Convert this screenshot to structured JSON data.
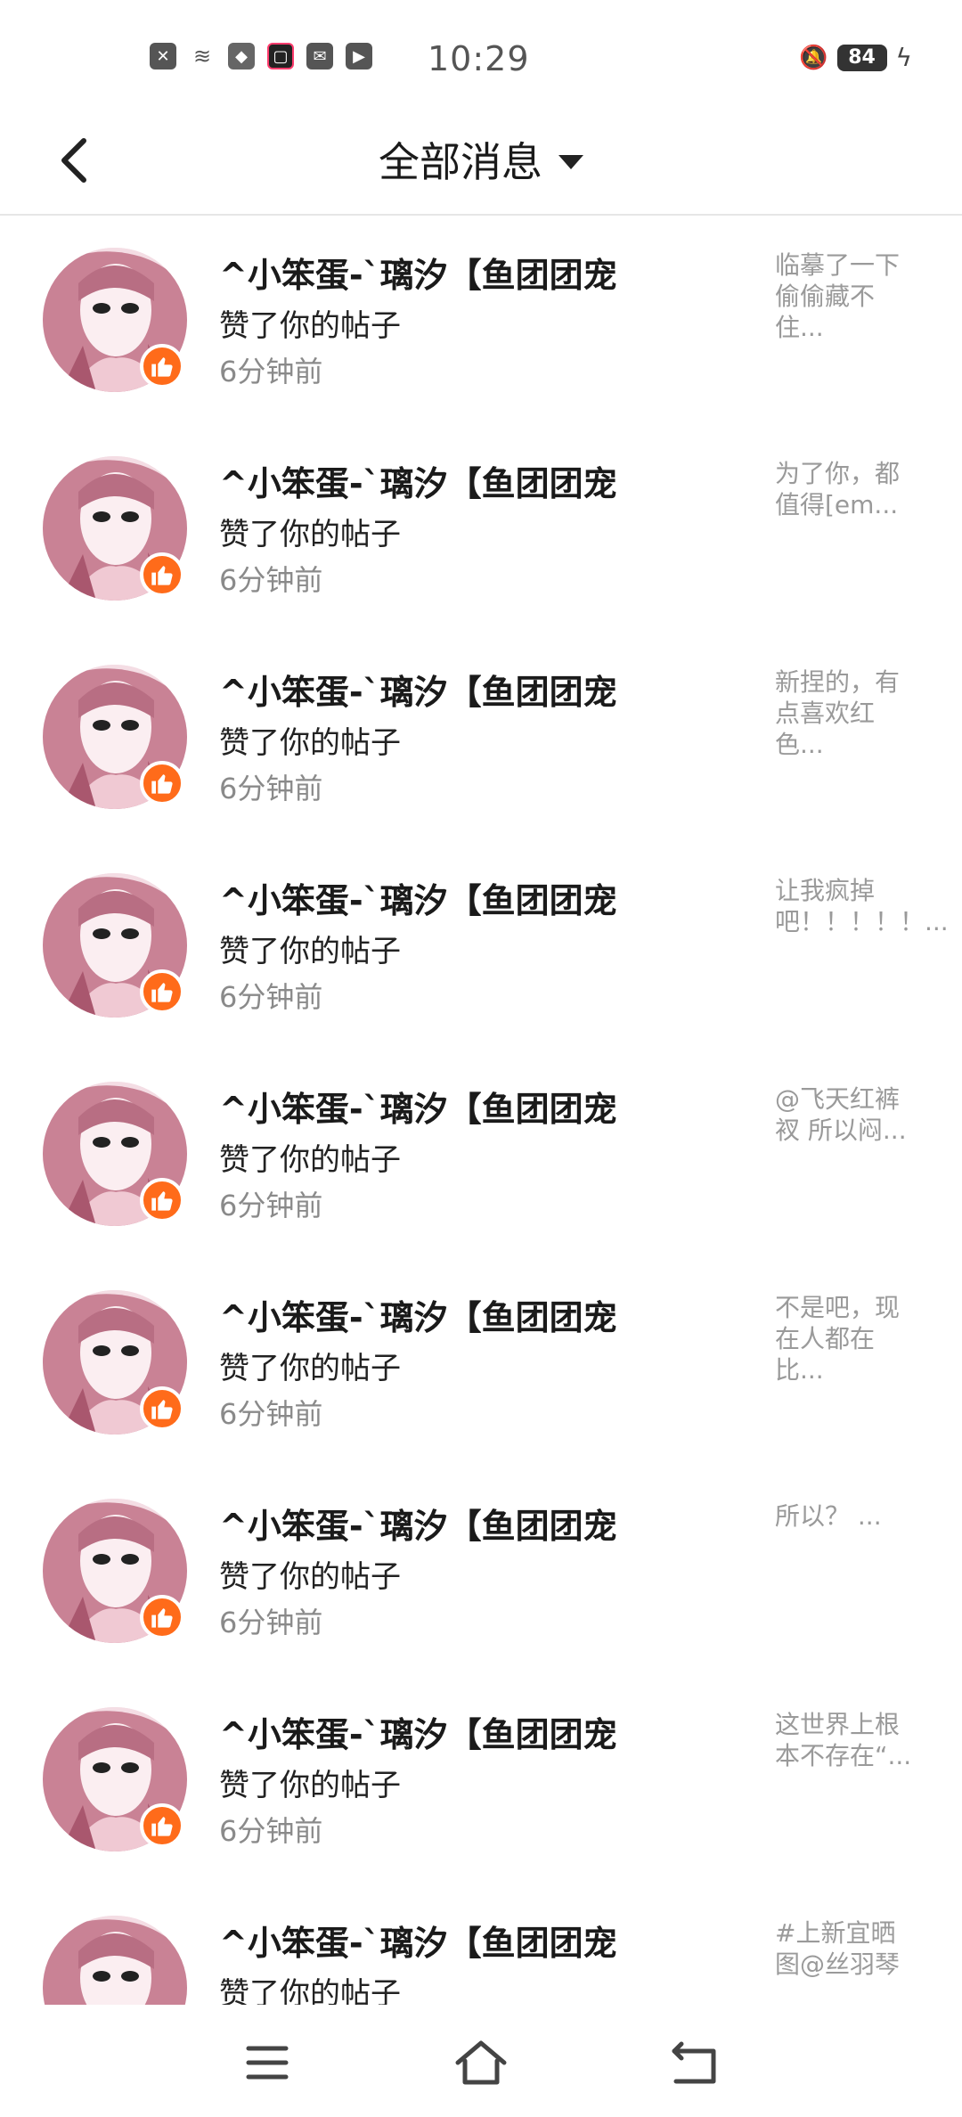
{
  "status_bar": {
    "time": "10:29",
    "battery": "84",
    "left_icons": [
      "close-icon",
      "wifi-icon",
      "app-icon",
      "screen-record-icon",
      "mail-icon",
      "play-icon"
    ],
    "right_icons": [
      "mute-icon",
      "battery-icon",
      "charging-icon"
    ]
  },
  "header": {
    "title": "全部消息",
    "back_icon": "back-arrow-icon",
    "dropdown_icon": "caret-down-icon"
  },
  "accent_color": "#ff6b1a",
  "messages": [
    {
      "name": "^小笨蛋-`璃汐【鱼团团宠",
      "action": "赞了你的帖子",
      "time": "6分钟前",
      "preview": "临摹了一下偷偷藏不住..."
    },
    {
      "name": "^小笨蛋-`璃汐【鱼团团宠",
      "action": "赞了你的帖子",
      "time": "6分钟前",
      "preview": "为了你，都值得[em..."
    },
    {
      "name": "^小笨蛋-`璃汐【鱼团团宠",
      "action": "赞了你的帖子",
      "time": "6分钟前",
      "preview": "新捏的，有点喜欢红色..."
    },
    {
      "name": "^小笨蛋-`璃汐【鱼团团宠",
      "action": "赞了你的帖子",
      "time": "6分钟前",
      "preview": "让我疯掉吧！！！！！..."
    },
    {
      "name": "^小笨蛋-`璃汐【鱼团团宠",
      "action": "赞了你的帖子",
      "time": "6分钟前",
      "preview": "@飞天红裤衩 所以闷..."
    },
    {
      "name": "^小笨蛋-`璃汐【鱼团团宠",
      "action": "赞了你的帖子",
      "time": "6分钟前",
      "preview": "不是吧，现在人都在比..."
    },
    {
      "name": "^小笨蛋-`璃汐【鱼团团宠",
      "action": "赞了你的帖子",
      "time": "6分钟前",
      "preview": "所以？ ..."
    },
    {
      "name": "^小笨蛋-`璃汐【鱼团团宠",
      "action": "赞了你的帖子",
      "time": "6分钟前",
      "preview": "这世界上根本不存在“..."
    },
    {
      "name": "^小笨蛋-`璃汐【鱼团团宠",
      "action": "赞了你的帖子",
      "time": "",
      "preview": "#上新宜晒图@丝羽琴"
    }
  ],
  "navbar": {
    "icons": [
      "menu-icon",
      "home-icon",
      "back-icon"
    ]
  }
}
